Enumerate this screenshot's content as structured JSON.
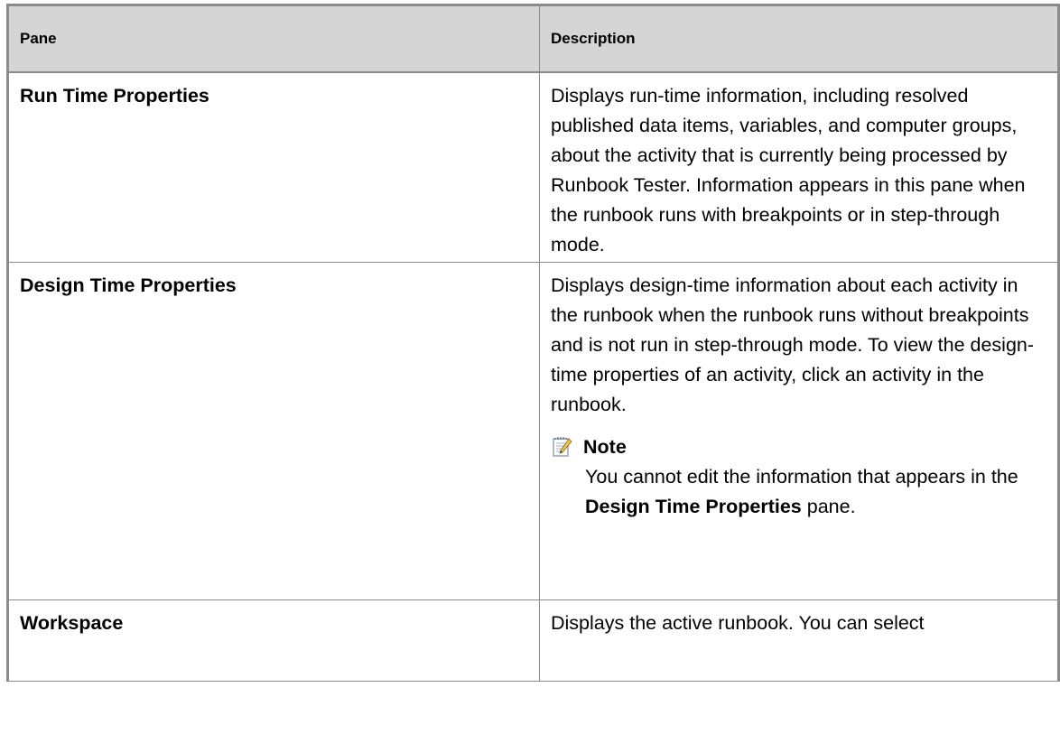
{
  "table": {
    "headers": {
      "pane": "Pane",
      "description": "Description"
    },
    "rows": [
      {
        "pane": "Run Time Properties",
        "description": "Displays run-time information, including resolved published data items, variables, and computer groups, about the activity that is currently being processed by Runbook Tester. Information appears in this pane when the runbook runs with breakpoints or in step-through mode."
      },
      {
        "pane": "Design Time Properties",
        "description": "Displays design-time information about each activity in the runbook when the runbook runs without breakpoints and is not run in step-through mode. To view the design-time properties of an activity, click an activity in the runbook.",
        "note": {
          "title": "Note",
          "icon": "note-pencil-icon",
          "text_before": "You cannot edit the information that appears in the ",
          "bold": "Design Time Properties",
          "text_after": " pane."
        }
      },
      {
        "pane": "Workspace",
        "description": "Displays the active runbook. You can select"
      }
    ]
  }
}
